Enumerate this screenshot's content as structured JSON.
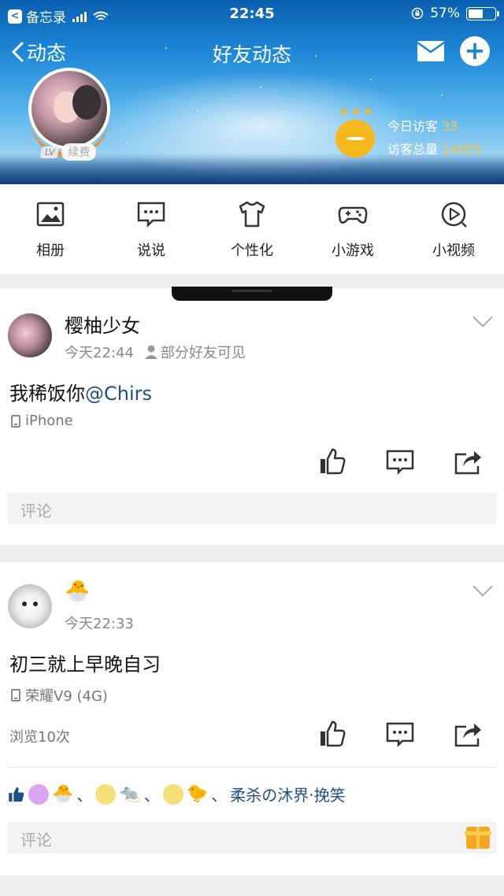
{
  "status_bar": {
    "back_app": "备忘录",
    "time": "22:45",
    "battery": "57%"
  },
  "nav": {
    "back_label": "动态",
    "title": "好友动态"
  },
  "profile": {
    "vip_level": "LV",
    "renew_label": "续费",
    "today_visitors_label": "今日访客",
    "today_visitors": "33",
    "total_visitors_label": "访客总量",
    "total_visitors": "14955"
  },
  "menu": [
    {
      "label": "相册",
      "icon": "photo-album-icon"
    },
    {
      "label": "说说",
      "icon": "chat-bubble-icon"
    },
    {
      "label": "个性化",
      "icon": "tshirt-icon"
    },
    {
      "label": "小游戏",
      "icon": "gamepad-icon"
    },
    {
      "label": "小视频",
      "icon": "video-play-icon"
    }
  ],
  "posts": [
    {
      "author": "樱柚少女",
      "time": "今天22:44",
      "visibility": "部分好友可见",
      "text": "我稀饭你",
      "mention": "@Chirs",
      "device": "iPhone",
      "comment_placeholder": "评论"
    },
    {
      "author_emoji": "🐣",
      "time": "今天22:33",
      "text": "初三就上早晚自习",
      "device": "荣耀V9 (4G)",
      "views": "浏览10次",
      "likes_sep": "、",
      "likes_name": "柔杀の沐界·挽笑",
      "comment_placeholder": "评论"
    }
  ],
  "colors": {
    "header_blue": "#1f8ad9",
    "link_blue": "#1f4f86",
    "visitor_number": "#f5c542",
    "ring_orange": "#f08a2a"
  }
}
